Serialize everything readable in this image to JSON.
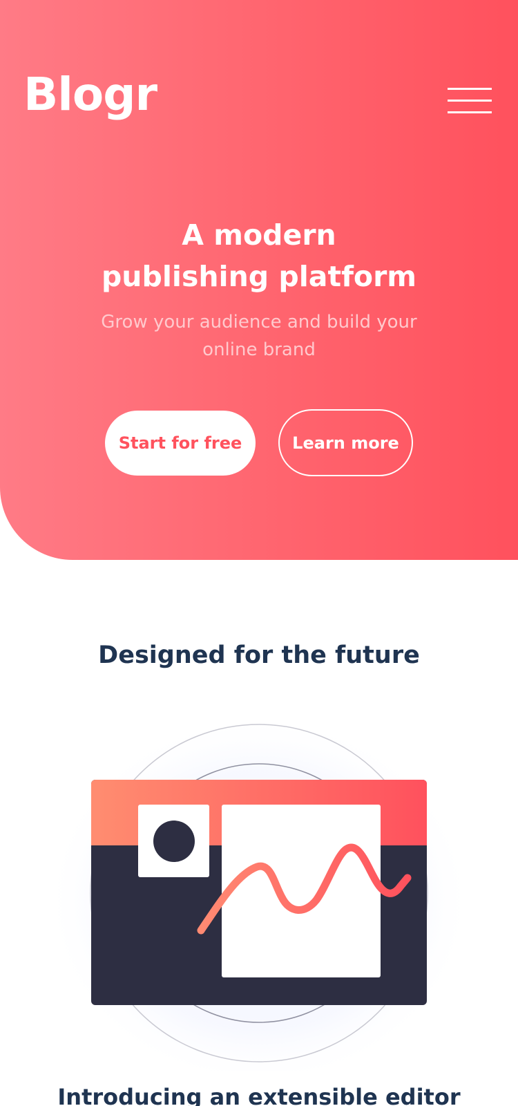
{
  "header": {
    "logo_text": "Blogr",
    "menu_icon": "hamburger-menu-icon"
  },
  "hero": {
    "title_line1": "A modern",
    "title_line2": "publishing platform",
    "subtitle": "Grow your audience and build your online brand",
    "primary_button": "Start for free",
    "secondary_button": "Learn more"
  },
  "features": {
    "title": "Designed for the future",
    "illustration_icon": "editor-illustration",
    "subtitle": "Introducing an extensible editor"
  },
  "colors": {
    "accent": "#ff525d",
    "hero_gradient_start": "#ff7b86",
    "hero_gradient_end": "#ff515d",
    "heading_text": "#1f3451",
    "dark_panel": "#2d2e42"
  }
}
